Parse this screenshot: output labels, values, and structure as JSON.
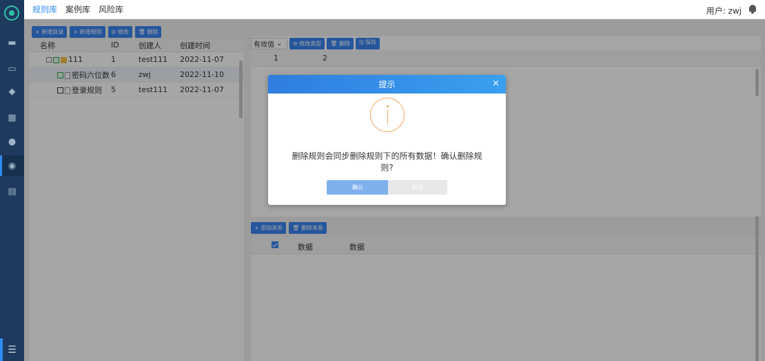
{
  "topnav": {
    "items": [
      "规则库",
      "案例库",
      "风险库"
    ],
    "active": 0,
    "user_label": "用户: zwj"
  },
  "left": {
    "toolbar": [
      "+ 新增目录",
      "+ 新增规则",
      "⊘ 修改",
      "🗑 删除"
    ],
    "headers": [
      "名称",
      "ID",
      "创建人",
      "创建时间"
    ],
    "rows": [
      {
        "name": "111",
        "id": "1",
        "creator": "test111",
        "time": "2022-11-07"
      },
      {
        "name": "密码六位数",
        "id": "6",
        "creator": "zwj",
        "time": "2022-11-10"
      },
      {
        "name": "登录规则",
        "id": "5",
        "creator": "test111",
        "time": "2022-11-07"
      }
    ]
  },
  "right": {
    "select_value": "有效值",
    "toolbar": [
      "⊘ 修改类型",
      "🗑 删除",
      "🖫 保存"
    ],
    "col_headers": [
      "1",
      "2"
    ]
  },
  "bottom": {
    "toolbar": [
      "+ 添加关系",
      "🗑 删除关系"
    ],
    "col_headers": [
      "数据",
      "数据"
    ]
  },
  "modal": {
    "title": "提示",
    "close": "×",
    "message": "删除规则会同步删除规则下的所有数据！确认删除规则?",
    "ok": "确认",
    "cancel": "取消"
  },
  "colors": {
    "accent": "#2d8cf0",
    "sidebar": "#1e3a5f",
    "warning": "#f2a35a"
  }
}
